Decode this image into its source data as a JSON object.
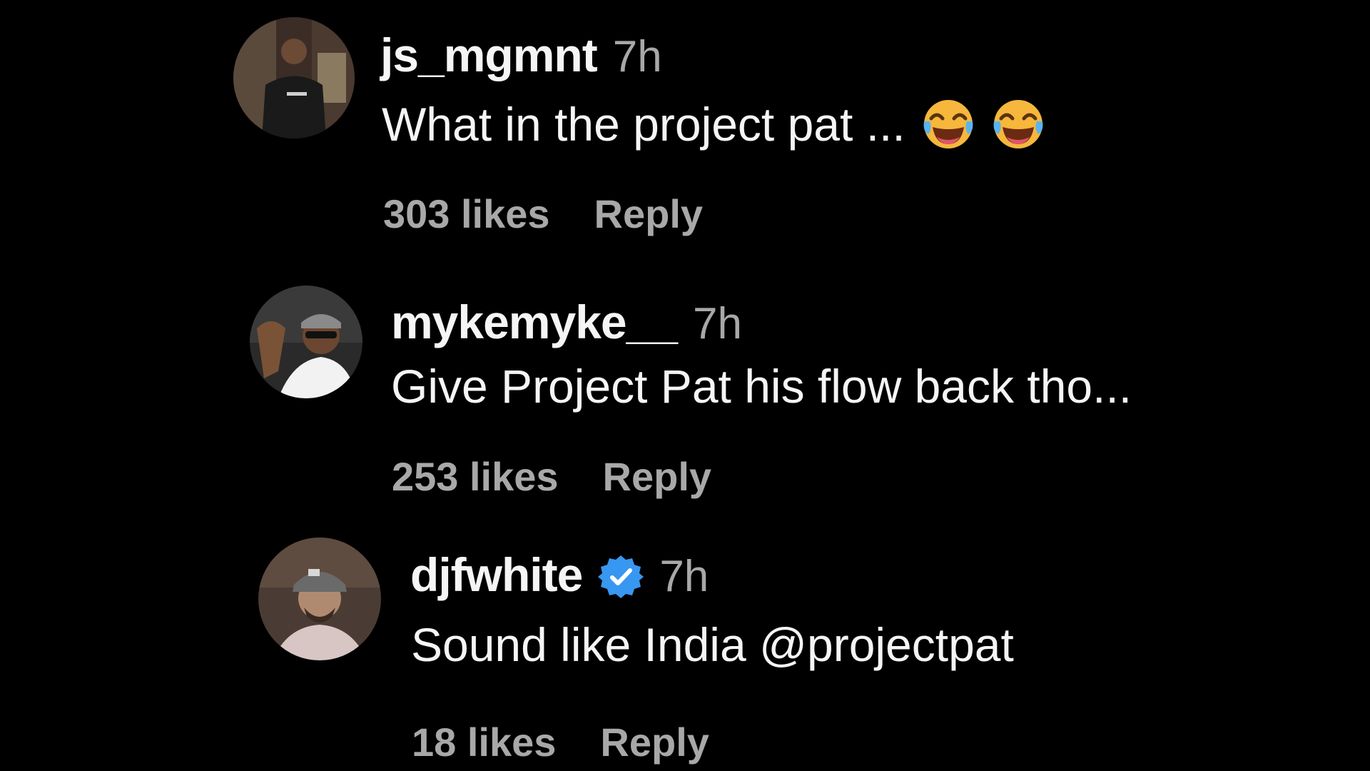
{
  "comments": [
    {
      "username": "js_mgmnt",
      "time": "7h",
      "text": "What in the project pat ...",
      "emojis": [
        "face-with-tears-of-joy",
        "face-with-tears-of-joy"
      ],
      "likes": "303 likes",
      "reply_label": "Reply",
      "verified": false
    },
    {
      "username": "mykemyke__",
      "time": "7h",
      "text": "Give Project Pat his flow back tho...",
      "likes": "253 likes",
      "reply_label": "Reply",
      "verified": false
    },
    {
      "username": "djfwhite",
      "time": "7h",
      "text": "Sound like India @projectpat",
      "likes": "18 likes",
      "reply_label": "Reply",
      "verified": true
    }
  ],
  "colors": {
    "background": "#000000",
    "primary_text": "#f5f5f5",
    "secondary_text": "#a8a8a8",
    "verified_badge": "#3897f0"
  }
}
